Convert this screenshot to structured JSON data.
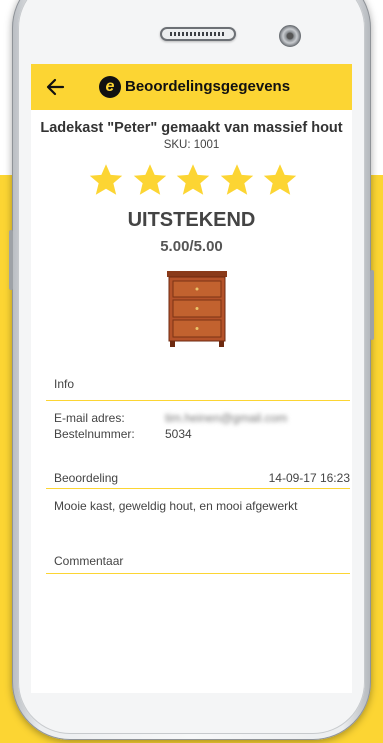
{
  "app_bar": {
    "title": "Beoordelingsgegevens",
    "logo_letter": "e",
    "back_icon": "arrow-left-icon",
    "color": "#fcd533"
  },
  "product": {
    "title": "Ladekast \"Peter\" gemaakt van massief hout",
    "sku": "SKU: 1001",
    "image": "wooden-nightstand-image"
  },
  "rating": {
    "stars": 5,
    "max_stars": 5,
    "word": "UITSTEKEND",
    "score": "5.00/5.00",
    "star_color": "#fcd533"
  },
  "info": {
    "section_label": "Info",
    "email_label": "E-mail adres:",
    "email_value": "tim.heinen@gmail.com",
    "order_label": "Bestelnummer:",
    "order_value": "5034"
  },
  "review": {
    "section_label": "Beoordeling",
    "date": "14-09-17  16:23",
    "text": "Mooie kast, geweldig hout, en mooi afgewerkt"
  },
  "comment": {
    "section_label": "Commentaar"
  }
}
